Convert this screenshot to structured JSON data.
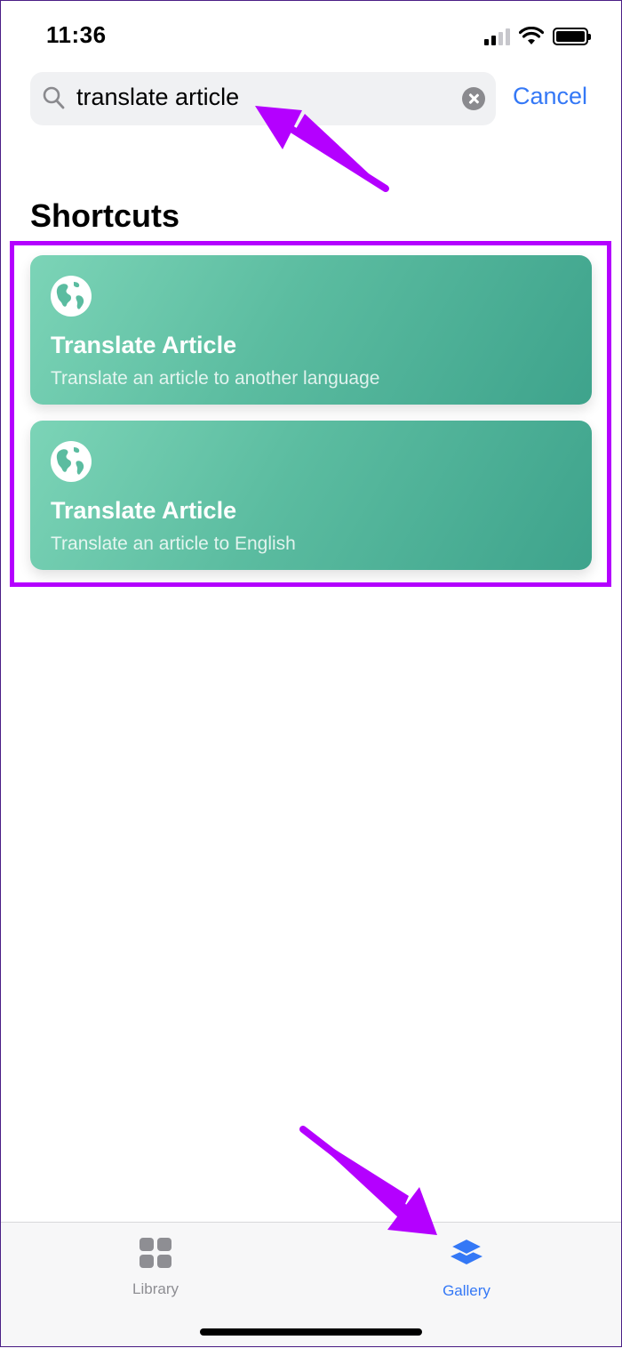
{
  "status_bar": {
    "time": "11:36"
  },
  "search": {
    "query": "translate article",
    "cancel_label": "Cancel"
  },
  "section": {
    "title": "Shortcuts"
  },
  "shortcuts": [
    {
      "title": "Translate Article",
      "subtitle": "Translate an article to another language",
      "icon": "globe-icon"
    },
    {
      "title": "Translate Article",
      "subtitle": "Translate an article to English",
      "icon": "globe-icon"
    }
  ],
  "tab_bar": {
    "tabs": [
      {
        "label": "Library",
        "icon": "grid-icon",
        "selected": false
      },
      {
        "label": "Gallery",
        "icon": "layers-icon",
        "selected": true
      }
    ]
  },
  "colors": {
    "accent": "#3478f6",
    "annotation": "#b400ff",
    "card_gradient_start": "#7cd4b7",
    "card_gradient_end": "#3ea38c"
  }
}
